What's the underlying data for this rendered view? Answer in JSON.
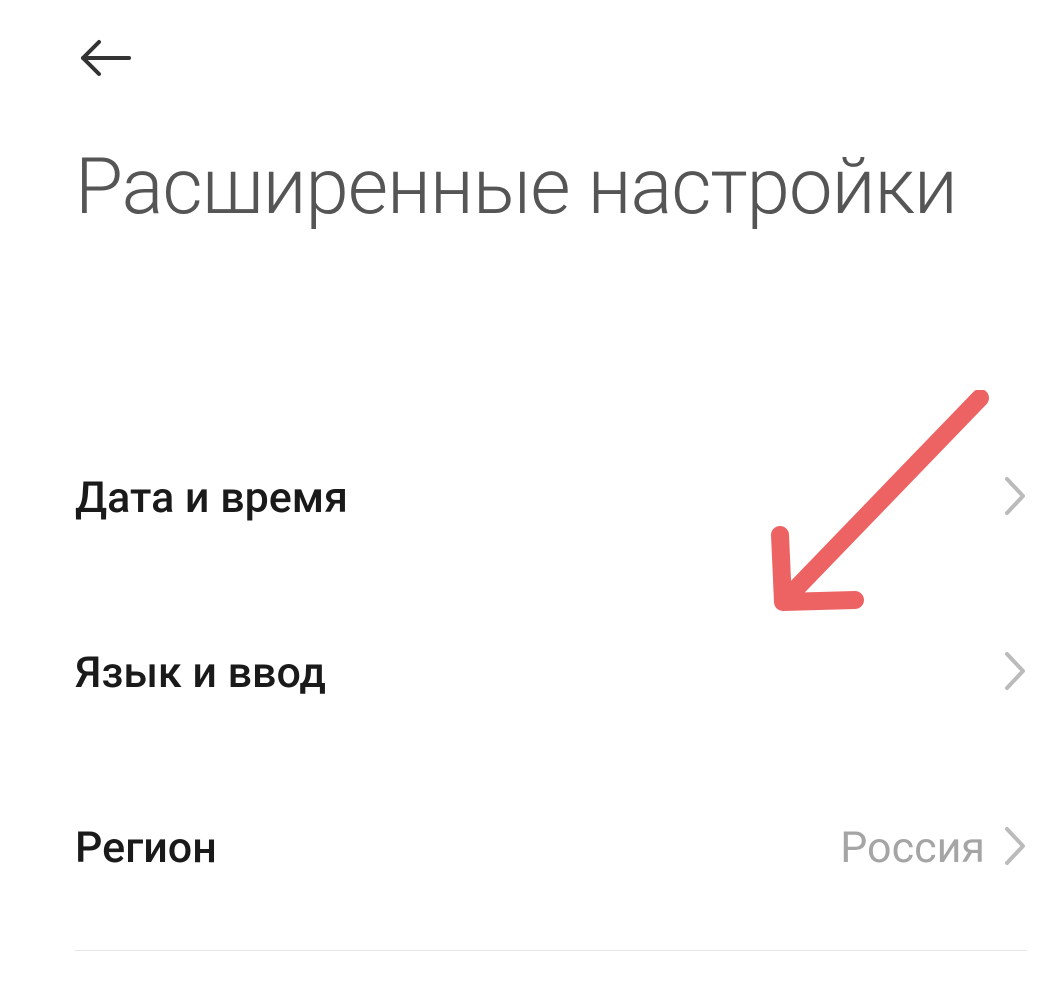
{
  "header": {
    "title": "Расширенные настройки"
  },
  "settings": {
    "items": [
      {
        "label": "Дата и время",
        "value": ""
      },
      {
        "label": "Язык и ввод",
        "value": ""
      },
      {
        "label": "Регион",
        "value": "Россия"
      }
    ]
  }
}
